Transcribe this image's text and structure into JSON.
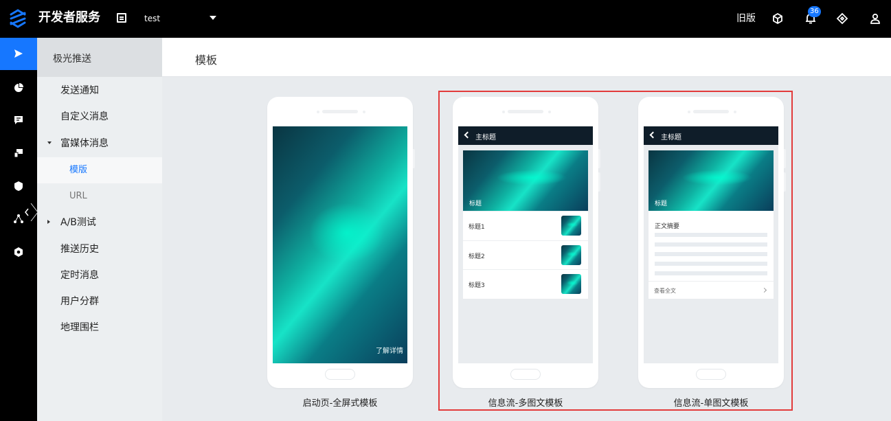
{
  "topbar": {
    "brand": "开发者服务",
    "app_name": "test",
    "old_version": "旧版",
    "notification_count": "36"
  },
  "rail": {
    "icons": [
      "send-icon",
      "chart-icon",
      "message-icon",
      "devices-icon",
      "shield-icon",
      "share-icon",
      "settings-icon"
    ]
  },
  "subnav": {
    "header": "极光推送",
    "items": [
      {
        "label": "发送通知"
      },
      {
        "label": "自定义消息"
      },
      {
        "label": "富媒体消息"
      },
      {
        "label": "模版"
      },
      {
        "label": "URL"
      },
      {
        "label": "A/B测试"
      },
      {
        "label": "推送历史"
      },
      {
        "label": "定时消息"
      },
      {
        "label": "用户分群"
      },
      {
        "label": "地理围栏"
      }
    ]
  },
  "main": {
    "title": "模板",
    "templates": [
      {
        "caption": "启动页-全屏式模板",
        "more_link": "了解详情"
      },
      {
        "caption": "信息流-多图文模板",
        "nav_title": "主标题",
        "hero_caption": "标题",
        "rows": [
          "标题1",
          "标题2",
          "标题3"
        ]
      },
      {
        "caption": "信息流-单图文模板",
        "nav_title": "主标题",
        "hero_caption": "标题",
        "summary": "正文摘要",
        "read_more": "查看全文"
      }
    ]
  },
  "colors": {
    "accent": "#1677ff",
    "highlight": "#e23b3b",
    "topbar": "#000000"
  }
}
